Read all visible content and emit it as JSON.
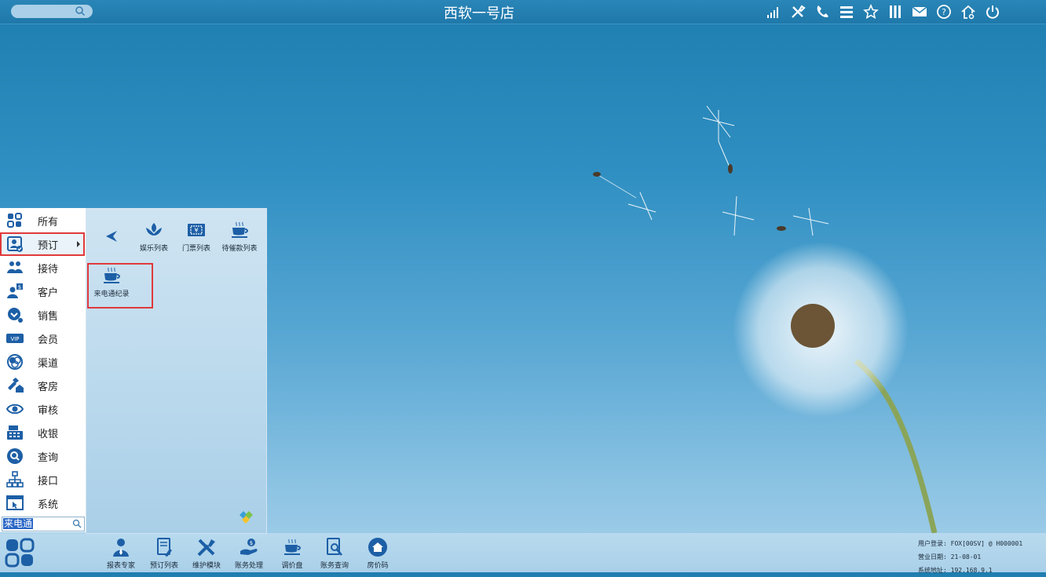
{
  "topbar": {
    "title": "西软一号店",
    "icons": [
      "signal-icon",
      "tools-icon",
      "phone-icon",
      "menu-icon",
      "star-icon",
      "columns-icon",
      "mail-icon",
      "help-icon",
      "home-settings-icon",
      "power-icon"
    ]
  },
  "left_menu": {
    "items": [
      {
        "label": "所有",
        "icon": "all-icon"
      },
      {
        "label": "预订",
        "icon": "reservation-icon",
        "active": true
      },
      {
        "label": "接待",
        "icon": "reception-icon"
      },
      {
        "label": "客户",
        "icon": "customer-icon"
      },
      {
        "label": "销售",
        "icon": "sales-icon"
      },
      {
        "label": "会员",
        "icon": "vip-icon"
      },
      {
        "label": "渠道",
        "icon": "channel-icon"
      },
      {
        "label": "客房",
        "icon": "room-icon"
      },
      {
        "label": "审核",
        "icon": "audit-icon"
      },
      {
        "label": "收银",
        "icon": "cashier-icon"
      },
      {
        "label": "查询",
        "icon": "query-icon"
      },
      {
        "label": "接口",
        "icon": "interface-icon"
      },
      {
        "label": "系统",
        "icon": "system-icon"
      }
    ],
    "search_value": "来电通"
  },
  "submenu": {
    "tiles": [
      {
        "label": "娱乐列表",
        "icon": "lotus-icon"
      },
      {
        "label": "门票列表",
        "icon": "ticket-icon"
      },
      {
        "label": "待催款列表",
        "icon": "coffee-icon"
      },
      {
        "label": "来电通纪录",
        "icon": "coffee-icon"
      }
    ]
  },
  "dock": {
    "items": [
      {
        "label": "报表专家",
        "icon": "report-expert-icon"
      },
      {
        "label": "预订列表",
        "icon": "booking-list-icon"
      },
      {
        "label": "维护模块",
        "icon": "maintenance-icon"
      },
      {
        "label": "账务处理",
        "icon": "accounting-icon"
      },
      {
        "label": "调价盘",
        "icon": "price-adjust-icon"
      },
      {
        "label": "账务查询",
        "icon": "account-query-icon"
      },
      {
        "label": "房价码",
        "icon": "rate-code-icon"
      }
    ]
  },
  "status": {
    "user_login": "用户登录: FOX[00SV] @ H000001",
    "business_date": "营业日期: 21-08-01",
    "system_address": "系统地址: 192.168.9.1"
  },
  "colors": {
    "accent": "#1d5fa6",
    "highlight_border": "#e0393b",
    "sky": "#2f8fc2"
  }
}
